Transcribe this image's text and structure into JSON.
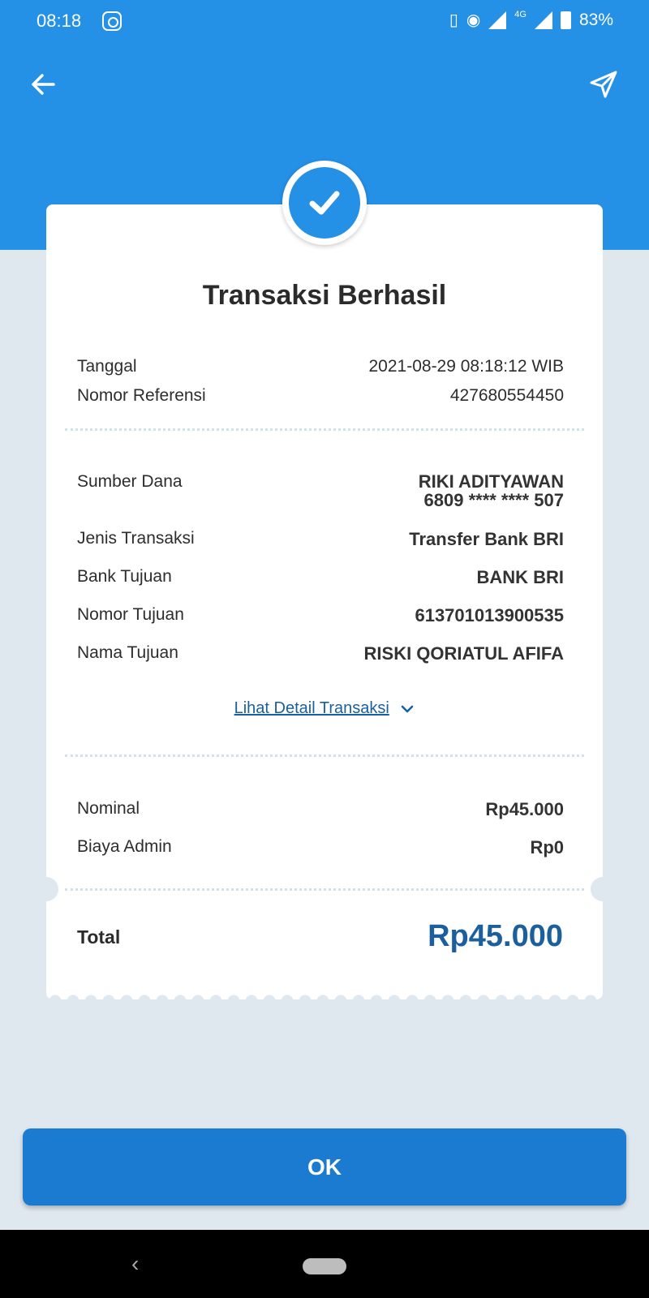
{
  "status_bar": {
    "time": "08:18",
    "network": "4G",
    "battery": "83%"
  },
  "header": {
    "back_icon": "arrow-left-icon",
    "share_icon": "send-icon"
  },
  "receipt": {
    "title": "Transaksi Berhasil",
    "tanggal": {
      "label": "Tanggal",
      "value": "2021-08-29 08:18:12 WIB"
    },
    "referensi": {
      "label": "Nomor Referensi",
      "value": "427680554450"
    },
    "sumber_dana": {
      "label": "Sumber Dana",
      "name": "RIKI ADITYAWAN",
      "account": "6809 **** **** 507"
    },
    "jenis": {
      "label": "Jenis Transaksi",
      "value": "Transfer Bank BRI"
    },
    "bank": {
      "label": "Bank Tujuan",
      "value": "BANK BRI"
    },
    "nomor_tujuan": {
      "label": "Nomor Tujuan",
      "value": "613701013900535"
    },
    "nama_tujuan": {
      "label": "Nama Tujuan",
      "value": "RISKI QORIATUL AFIFA"
    },
    "detail_link": "Lihat Detail Transaksi",
    "nominal": {
      "label": "Nominal",
      "value": "Rp45.000"
    },
    "admin": {
      "label": "Biaya Admin",
      "value": "Rp0"
    },
    "total": {
      "label": "Total",
      "value": "Rp45.000"
    }
  },
  "ok_button": "OK",
  "colors": {
    "primary": "#2490e6",
    "button": "#1a7bd0",
    "accent_text": "#1b5f9f",
    "background": "#dfe7ef"
  }
}
